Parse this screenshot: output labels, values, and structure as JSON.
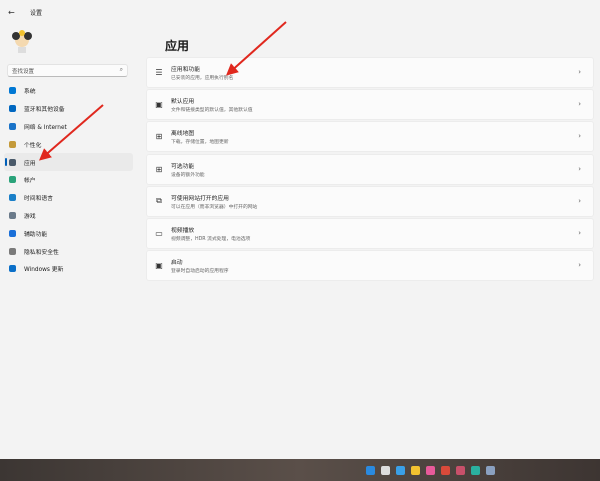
{
  "window": {
    "title": "设置",
    "back_icon": "back-arrow-icon"
  },
  "search": {
    "placeholder": "查找设置",
    "icon": "search-icon"
  },
  "sidebar": {
    "items": [
      {
        "label": "系统",
        "icon": "system-icon",
        "color": "#0078d4"
      },
      {
        "label": "蓝牙和其他设备",
        "icon": "bluetooth-icon",
        "color": "#0067c0"
      },
      {
        "label": "网络 & Internet",
        "icon": "network-icon",
        "color": "#1a73c8"
      },
      {
        "label": "个性化",
        "icon": "brush-icon",
        "color": "#c49a3a"
      },
      {
        "label": "应用",
        "icon": "apps-icon",
        "color": "#4a5a6a",
        "active": true
      },
      {
        "label": "帐户",
        "icon": "account-icon",
        "color": "#2aa37a"
      },
      {
        "label": "时间和语言",
        "icon": "time-language-icon",
        "color": "#1a7fc8"
      },
      {
        "label": "游戏",
        "icon": "gaming-icon",
        "color": "#6a7a8a"
      },
      {
        "label": "辅助功能",
        "icon": "accessibility-icon",
        "color": "#1a6fd8"
      },
      {
        "label": "隐私和安全性",
        "icon": "shield-icon",
        "color": "#7a7a7a"
      },
      {
        "label": "Windows 更新",
        "icon": "update-icon",
        "color": "#0a6fc8"
      }
    ]
  },
  "main": {
    "title": "应用",
    "cards": [
      {
        "title": "应用和功能",
        "subtitle": "已安装的应用，应用执行别名",
        "icon": "list-icon",
        "glyph": "☰"
      },
      {
        "title": "默认应用",
        "subtitle": "文件和链接类型的默认值，其他默认值",
        "icon": "default-apps-icon",
        "glyph": "▣"
      },
      {
        "title": "离线地图",
        "subtitle": "下载，存储位置，地图更新",
        "icon": "map-icon",
        "glyph": "⊞"
      },
      {
        "title": "可选功能",
        "subtitle": "设备的额外功能",
        "icon": "optional-features-icon",
        "glyph": "⊞"
      },
      {
        "title": "可使用网站打开的应用",
        "subtitle": "可以在应用（而非浏览器）中打开的网站",
        "icon": "web-apps-icon",
        "glyph": "⧉"
      },
      {
        "title": "视频播放",
        "subtitle": "视频调整，HDR 流式处理，电池选项",
        "icon": "video-icon",
        "glyph": "▭"
      },
      {
        "title": "启动",
        "subtitle": "登录时自动启动的应用程序",
        "icon": "startup-icon",
        "glyph": "▣"
      }
    ]
  },
  "taskbar": {
    "icons": [
      {
        "name": "start-icon",
        "color": "#2a8ae0"
      },
      {
        "name": "search-icon",
        "color": "#dddddd"
      },
      {
        "name": "task-view-icon",
        "color": "#3aa0e8"
      },
      {
        "name": "file-explorer-icon",
        "color": "#f2c230"
      },
      {
        "name": "browser-icon",
        "color": "#e85a9a"
      },
      {
        "name": "chrome-icon",
        "color": "#d94a3a"
      },
      {
        "name": "app-icon",
        "color": "#c8506a"
      },
      {
        "name": "edge-icon",
        "color": "#2ab0a0"
      },
      {
        "name": "settings-icon",
        "color": "#8aa0c0"
      }
    ]
  },
  "annotation_color": "#e0281e"
}
